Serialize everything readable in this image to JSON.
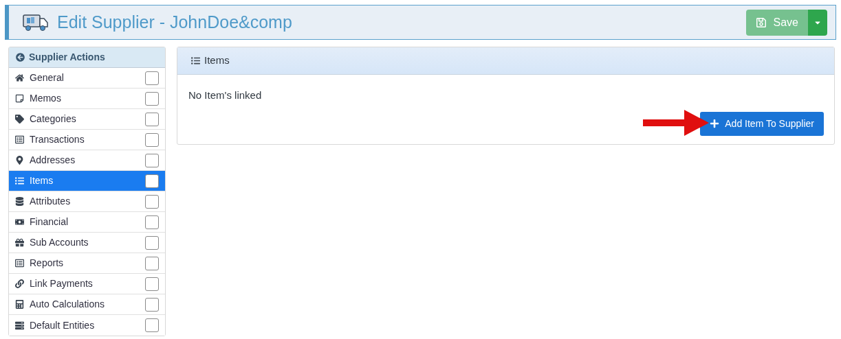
{
  "header": {
    "title": "Edit Supplier - JohnDoe&comp",
    "save_button": {
      "label": "Save",
      "disabled": true
    }
  },
  "sidebar": {
    "title": "Supplier Actions",
    "items": [
      {
        "label": "General",
        "selected": false,
        "checked": false
      },
      {
        "label": "Memos",
        "selected": false,
        "checked": false
      },
      {
        "label": "Categories",
        "selected": false,
        "checked": false
      },
      {
        "label": "Transactions",
        "selected": false,
        "checked": false
      },
      {
        "label": "Addresses",
        "selected": false,
        "checked": false
      },
      {
        "label": "Items",
        "selected": true,
        "checked": false
      },
      {
        "label": "Attributes",
        "selected": false,
        "checked": false
      },
      {
        "label": "Financial",
        "selected": false,
        "checked": false
      },
      {
        "label": "Sub Accounts",
        "selected": false,
        "checked": false
      },
      {
        "label": "Reports",
        "selected": false,
        "checked": false
      },
      {
        "label": "Link Payments",
        "selected": false,
        "checked": false
      },
      {
        "label": "Auto Calculations",
        "selected": false,
        "checked": false
      },
      {
        "label": "Default Entities",
        "selected": false,
        "checked": false
      }
    ]
  },
  "panel": {
    "title": "Items",
    "message": "No Item's linked",
    "add_button": "Add Item To Supplier"
  }
}
